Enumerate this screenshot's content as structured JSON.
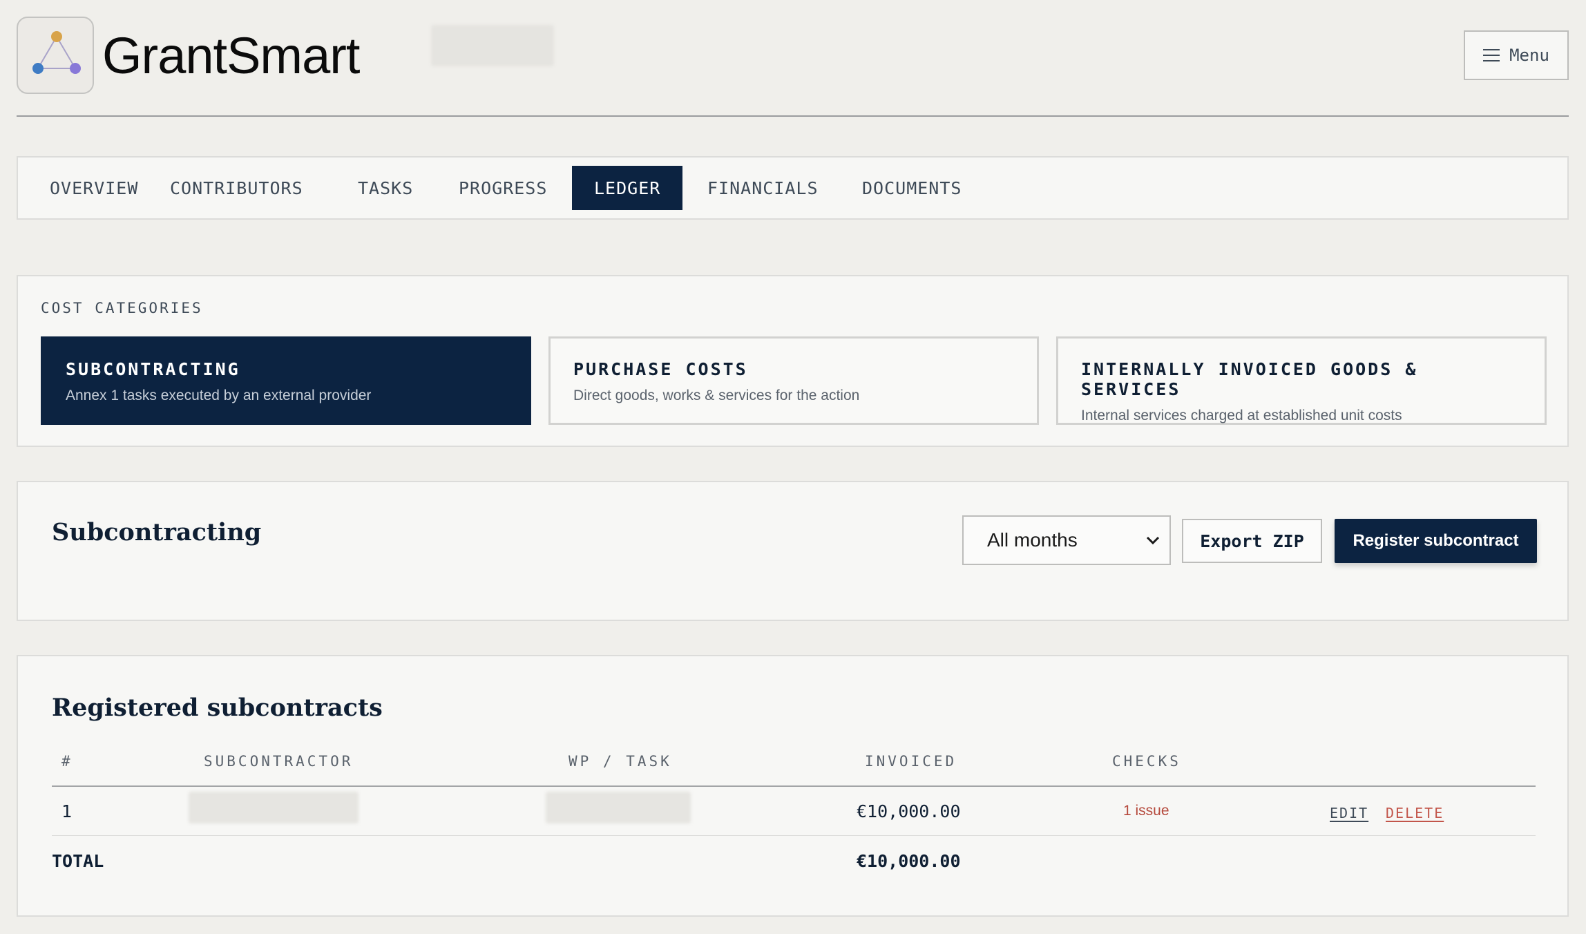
{
  "header": {
    "brand": "GrantSmart",
    "menu_label": "Menu"
  },
  "tabs": [
    {
      "label": "OVERVIEW",
      "active": false
    },
    {
      "label": "CONTRIBUTORS",
      "active": false
    },
    {
      "label": "TASKS",
      "active": false
    },
    {
      "label": "PROGRESS",
      "active": false
    },
    {
      "label": "LEDGER",
      "active": true
    },
    {
      "label": "FINANCIALS",
      "active": false
    },
    {
      "label": "DOCUMENTS",
      "active": false
    }
  ],
  "cost_categories": {
    "label": "COST CATEGORIES",
    "items": [
      {
        "title": "SUBCONTRACTING",
        "description": "Annex 1 tasks executed by an external provider",
        "active": true
      },
      {
        "title": "PURCHASE COSTS",
        "description": "Direct goods, works & services for the action",
        "active": false
      },
      {
        "title": "INTERNALLY INVOICED GOODS & SERVICES",
        "description": "Internal services charged at established unit costs",
        "active": false
      }
    ]
  },
  "subcontracting": {
    "title": "Subcontracting",
    "month_filter": "All months",
    "export_label": "Export ZIP",
    "register_label": "Register subcontract"
  },
  "registered": {
    "title": "Registered subcontracts",
    "columns": [
      "#",
      "SUBCONTRACTOR",
      "WP / TASK",
      "INVOICED",
      "CHECKS"
    ],
    "rows": [
      {
        "num": "1",
        "invoiced": "€10,000.00",
        "checks": "1 issue",
        "edit": "EDIT",
        "delete": "DELETE"
      }
    ],
    "total_label": "TOTAL",
    "total_value": "€10,000.00"
  },
  "colors": {
    "navy": "#0c2341",
    "background": "#f0efeb",
    "issue_red": "#b5493c"
  }
}
